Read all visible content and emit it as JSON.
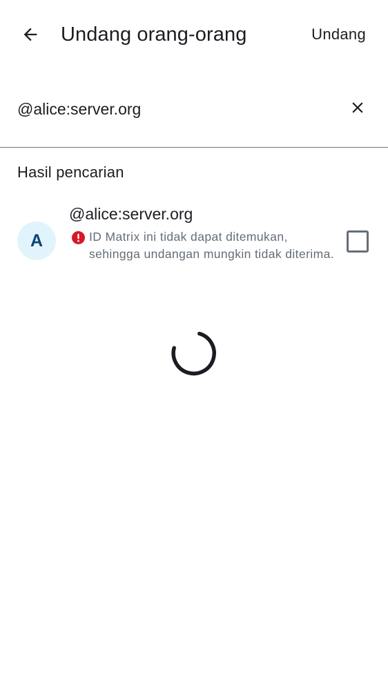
{
  "header": {
    "title": "Undang orang-orang",
    "invite_label": "Undang",
    "back_icon": "arrow-back-icon"
  },
  "search": {
    "value": "@alice:server.org",
    "clear_icon": "close-icon"
  },
  "results": {
    "heading": "Hasil pencarian",
    "items": [
      {
        "avatar_letter": "A",
        "name": "@alice:server.org",
        "warning_icon": "error-icon",
        "warning": "ID Matrix ini tidak dapat ditemukan, sehingga undangan mungkin tidak diterima.",
        "selected": false
      }
    ]
  },
  "loading": true,
  "colors": {
    "text_primary": "#1b1d22",
    "text_secondary": "#656d77",
    "error": "#d51928",
    "avatar_bg": "#e1f4fb",
    "avatar_fg": "#0c4276"
  }
}
